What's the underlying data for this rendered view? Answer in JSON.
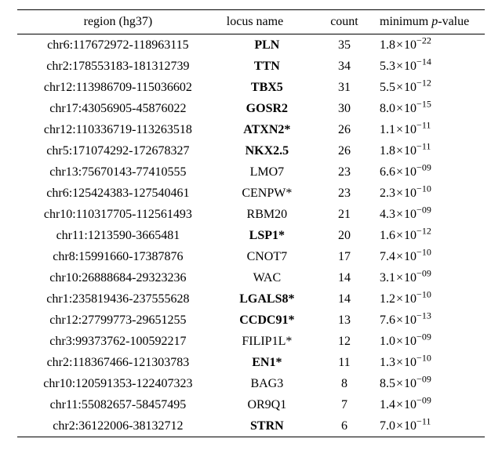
{
  "chart_data": {
    "type": "table",
    "title": "",
    "columns": [
      "region (hg37)",
      "locus name",
      "count",
      "minimum p-value"
    ],
    "rows": [
      {
        "region": "chr6:117672972-118963115",
        "locus": "PLN",
        "bold": true,
        "count": 35,
        "p_mantissa": "1.8",
        "p_exponent": -22
      },
      {
        "region": "chr2:178553183-181312739",
        "locus": "TTN",
        "bold": true,
        "count": 34,
        "p_mantissa": "5.3",
        "p_exponent": -14
      },
      {
        "region": "chr12:113986709-115036602",
        "locus": "TBX5",
        "bold": true,
        "count": 31,
        "p_mantissa": "5.5",
        "p_exponent": -12
      },
      {
        "region": "chr17:43056905-45876022",
        "locus": "GOSR2",
        "bold": true,
        "count": 30,
        "p_mantissa": "8.0",
        "p_exponent": -15
      },
      {
        "region": "chr12:110336719-113263518",
        "locus": "ATXN2*",
        "bold": true,
        "count": 26,
        "p_mantissa": "1.1",
        "p_exponent": -11
      },
      {
        "region": "chr5:171074292-172678327",
        "locus": "NKX2.5",
        "bold": true,
        "count": 26,
        "p_mantissa": "1.8",
        "p_exponent": -11
      },
      {
        "region": "chr13:75670143-77410555",
        "locus": "LMO7",
        "bold": false,
        "count": 23,
        "p_mantissa": "6.6",
        "p_exponent": -9
      },
      {
        "region": "chr6:125424383-127540461",
        "locus": "CENPW*",
        "bold": false,
        "count": 23,
        "p_mantissa": "2.3",
        "p_exponent": -10
      },
      {
        "region": "chr10:110317705-112561493",
        "locus": "RBM20",
        "bold": false,
        "count": 21,
        "p_mantissa": "4.3",
        "p_exponent": -9
      },
      {
        "region": "chr11:1213590-3665481",
        "locus": "LSP1*",
        "bold": true,
        "count": 20,
        "p_mantissa": "1.6",
        "p_exponent": -12
      },
      {
        "region": "chr8:15991660-17387876",
        "locus": "CNOT7",
        "bold": false,
        "count": 17,
        "p_mantissa": "7.4",
        "p_exponent": -10
      },
      {
        "region": "chr10:26888684-29323236",
        "locus": "WAC",
        "bold": false,
        "count": 14,
        "p_mantissa": "3.1",
        "p_exponent": -9
      },
      {
        "region": "chr1:235819436-237555628",
        "locus": "LGALS8*",
        "bold": true,
        "count": 14,
        "p_mantissa": "1.2",
        "p_exponent": -10
      },
      {
        "region": "chr12:27799773-29651255",
        "locus": "CCDC91*",
        "bold": true,
        "count": 13,
        "p_mantissa": "7.6",
        "p_exponent": -13
      },
      {
        "region": "chr3:99373762-100592217",
        "locus": "FILIP1L*",
        "bold": false,
        "count": 12,
        "p_mantissa": "1.0",
        "p_exponent": -9
      },
      {
        "region": "chr2:118367466-121303783",
        "locus": "EN1*",
        "bold": true,
        "count": 11,
        "p_mantissa": "1.3",
        "p_exponent": -10
      },
      {
        "region": "chr10:120591353-122407323",
        "locus": "BAG3",
        "bold": false,
        "count": 8,
        "p_mantissa": "8.5",
        "p_exponent": -9
      },
      {
        "region": "chr11:55082657-58457495",
        "locus": "OR9Q1",
        "bold": false,
        "count": 7,
        "p_mantissa": "1.4",
        "p_exponent": -9
      },
      {
        "region": "chr2:36122006-38132712",
        "locus": "STRN",
        "bold": true,
        "count": 6,
        "p_mantissa": "7.0",
        "p_exponent": -11
      }
    ]
  },
  "headers": {
    "region": "region (hg37)",
    "locus": "locus name",
    "count": "count",
    "pval_pre": "minimum ",
    "pval_var": "p",
    "pval_post": "-value"
  }
}
